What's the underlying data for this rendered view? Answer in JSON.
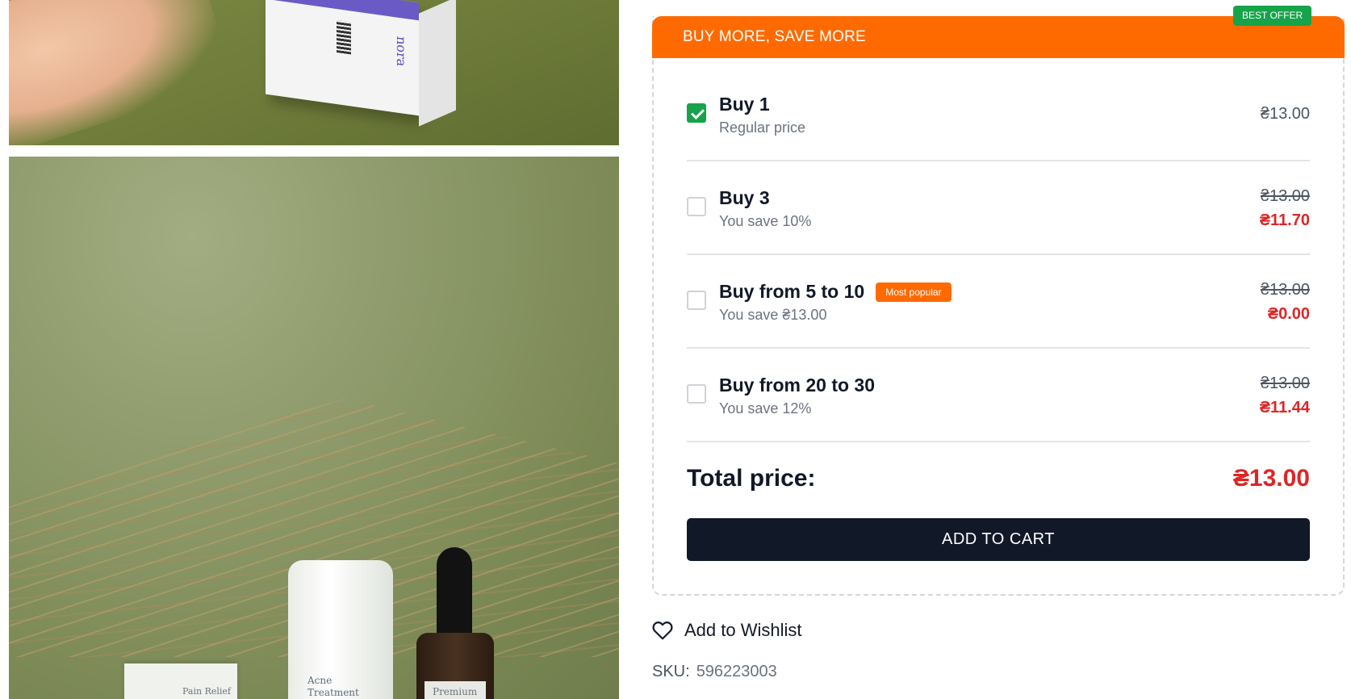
{
  "offer": {
    "header_title": "BUY MORE, SAVE MORE",
    "best_badge": "BEST OFFER",
    "options": [
      {
        "title": "Buy 1",
        "subtitle": "Regular price",
        "checked": true,
        "price": "₴13.00"
      },
      {
        "title": "Buy 3",
        "subtitle": "You save 10%",
        "checked": false,
        "old_price": "₴13.00",
        "new_price": "₴11.70"
      },
      {
        "title": "Buy from 5 to 10",
        "subtitle": "You save ₴13.00",
        "checked": false,
        "badge": "Most popular",
        "old_price": "₴13.00",
        "new_price": "₴0.00"
      },
      {
        "title": "Buy from 20 to 30",
        "subtitle": "You save 12%",
        "checked": false,
        "old_price": "₴13.00",
        "new_price": "₴11.44"
      }
    ],
    "total_label": "Total price:",
    "total_value": "₴13.00",
    "add_to_cart": "ADD TO CART"
  },
  "wishlist": {
    "label": "Add to Wishlist",
    "icon": "heart-icon"
  },
  "sku": {
    "label": "SKU:",
    "value": "596223003"
  },
  "gallery": {
    "image1": {
      "brand_text": "nora"
    },
    "image2": {
      "jar_label": [
        "Acne",
        "Treatment"
      ],
      "bottle_label": "Premium",
      "box_label": "Pain Relief"
    }
  },
  "colors": {
    "accent": "#ff6a00",
    "success": "#16a34a",
    "sale": "#dc2626",
    "button": "#111827"
  }
}
